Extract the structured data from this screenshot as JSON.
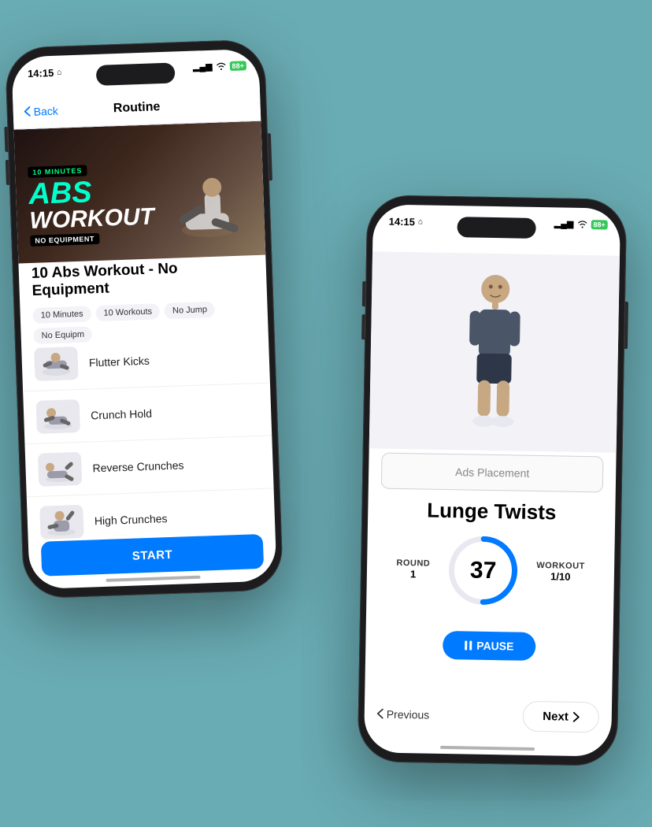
{
  "scene": {
    "background_color": "#6aacb4"
  },
  "phone1": {
    "status": {
      "time": "14:15",
      "home_icon": "🏠",
      "signal_bars": "▂▄▆",
      "wifi": "wifi-icon",
      "battery": "88+"
    },
    "nav": {
      "back_label": "Back",
      "title": "Routine"
    },
    "hero": {
      "minutes_badge": "10 MINUTES",
      "title_line1": "ABS",
      "title_line2": "WORKOUT",
      "no_equip_badge": "NO EQUIPMENT"
    },
    "workout": {
      "title": "10 Abs Workout - No Equipment",
      "tags": [
        "10 Minutes",
        "10 Workouts",
        "No Jump",
        "No Equipm"
      ]
    },
    "exercises": [
      {
        "name": "Flutter Kicks"
      },
      {
        "name": "Crunch Hold"
      },
      {
        "name": "Reverse Crunches"
      },
      {
        "name": "High Crunches"
      }
    ],
    "start_button": "START"
  },
  "phone2": {
    "status": {
      "time": "14:15",
      "home_icon": "🏠",
      "signal_bars": "▂▄▆",
      "wifi": "wifi-icon",
      "battery": "88+"
    },
    "back_arrow": "←",
    "ads_placement": "Ads Placement",
    "exercise_name": "Lunge Twists",
    "timer": {
      "round_label": "ROUND",
      "round_value": "1",
      "count": "37",
      "workout_label": "WORKOUT",
      "workout_value": "1/10"
    },
    "pause_button": "PAUSE",
    "previous_button": "Previous",
    "next_button": "Next"
  }
}
